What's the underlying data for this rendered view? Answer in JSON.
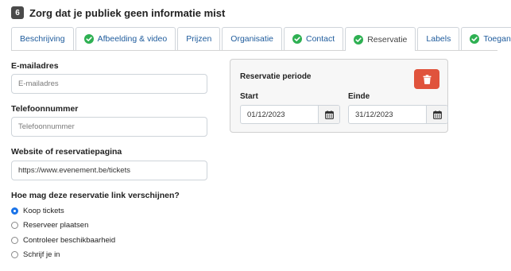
{
  "header": {
    "step_number": "6",
    "title": "Zorg dat je publiek geen informatie mist"
  },
  "tabs": [
    {
      "label": "Beschrijving",
      "checked": false,
      "active": false
    },
    {
      "label": "Afbeelding & video",
      "checked": true,
      "active": false
    },
    {
      "label": "Prijzen",
      "checked": false,
      "active": false
    },
    {
      "label": "Organisatie",
      "checked": false,
      "active": false
    },
    {
      "label": "Contact",
      "checked": true,
      "active": false
    },
    {
      "label": "Reservatie",
      "checked": true,
      "active": true
    },
    {
      "label": "Labels",
      "checked": false,
      "active": false
    },
    {
      "label": "Toegang",
      "checked": true,
      "active": false
    }
  ],
  "form": {
    "email": {
      "label": "E-mailadres",
      "placeholder": "E-mailadres",
      "value": ""
    },
    "phone": {
      "label": "Telefoonnummer",
      "placeholder": "Telefoonnummer",
      "value": ""
    },
    "website": {
      "label": "Website of reservatiepagina",
      "placeholder": "",
      "value": "https://www.evenement.be/tickets"
    },
    "link_label": {
      "label": "Hoe mag deze reservatie link verschijnen?",
      "options": [
        "Koop tickets",
        "Reserveer plaatsen",
        "Controleer beschikbaarheid",
        "Schrijf je in"
      ],
      "selected": "Koop tickets"
    }
  },
  "reservation_period": {
    "title": "Reservatie periode",
    "start_label": "Start",
    "start_value": "01/12/2023",
    "end_label": "Einde",
    "end_value": "31/12/2023"
  },
  "colors": {
    "check_green": "#2eb052",
    "delete_red": "#e0533c",
    "link_blue": "#1e5b9c"
  },
  "icons": {
    "tab_check": "check-circle-icon",
    "delete": "trash-icon",
    "date_picker": "calendar-icon"
  }
}
